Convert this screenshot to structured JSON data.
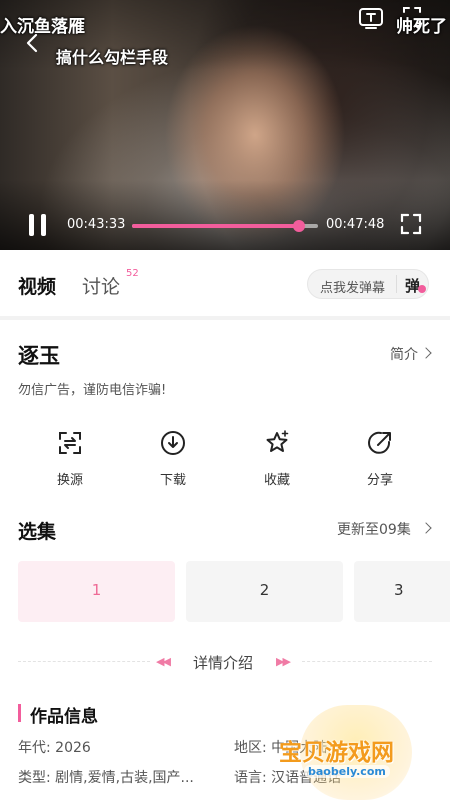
{
  "player": {
    "danmu_left": "入沉鱼落雁",
    "danmu_right": "帅死了",
    "title": "搞什么勾栏手段",
    "current_time": "00:43:33",
    "total_time": "00:47:48",
    "progress_percent": 90,
    "icons": [
      "back-icon",
      "tv-cast-icon",
      "share-icon",
      "pause-icon",
      "fullscreen-icon"
    ],
    "accent_color": "#f25d9c"
  },
  "tabs": {
    "video": "视频",
    "comments": "讨论",
    "comments_badge": "52",
    "danmu_placeholder": "点我发弹幕",
    "danmu_button": "弹"
  },
  "show": {
    "title": "逐玉",
    "intro_link": "简介",
    "notice": "勿信广告，谨防电信诈骗!"
  },
  "actions": [
    {
      "label": "换源",
      "icon": "switch-source-icon"
    },
    {
      "label": "下载",
      "icon": "download-icon"
    },
    {
      "label": "收藏",
      "icon": "star-icon"
    },
    {
      "label": "分享",
      "icon": "share-icon"
    }
  ],
  "episodes": {
    "heading": "选集",
    "update_status": "更新至09集",
    "items": [
      "1",
      "2",
      "3"
    ],
    "selected": "1"
  },
  "details": {
    "label": "详情介绍"
  },
  "work_info": {
    "heading": "作品信息",
    "year": "年代:  2026",
    "genre": "类型:  剧情,爱情,古装,国产...",
    "region": "地区:  中国大陆",
    "language": "语言:  汉语普通话"
  },
  "watermark": {
    "text": "宝贝游戏网",
    "url": "baobely.com"
  }
}
